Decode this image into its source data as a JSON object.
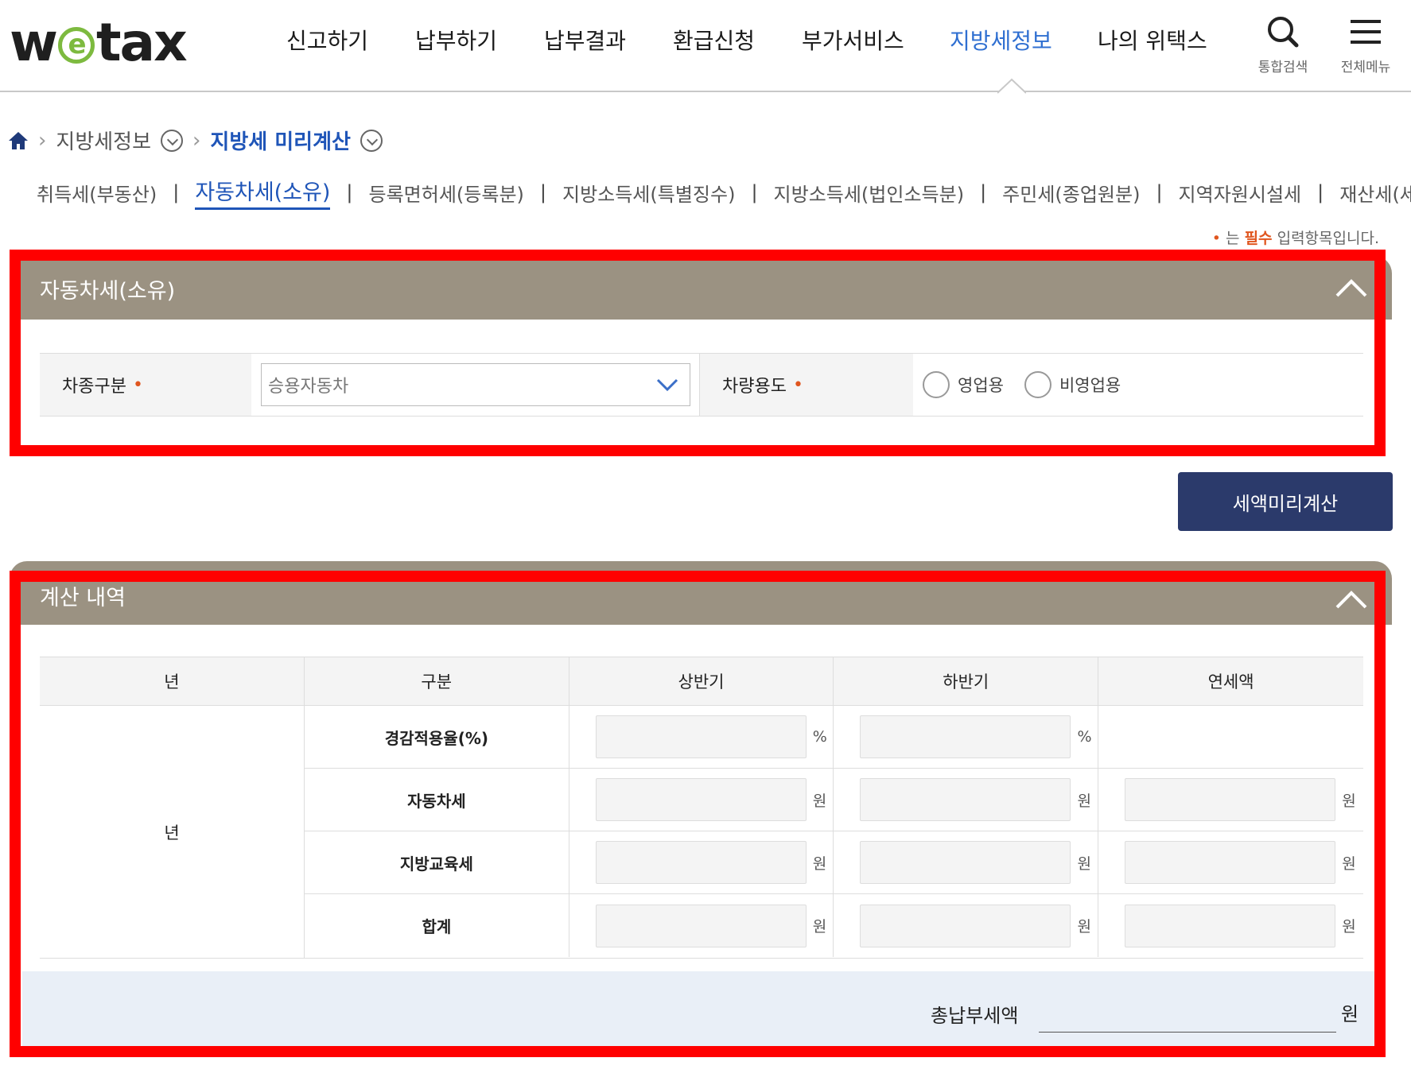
{
  "header": {
    "logo": {
      "pre": "w",
      "e": "e",
      "post": "tax"
    },
    "nav": [
      "신고하기",
      "납부하기",
      "납부결과",
      "환급신청",
      "부가서비스",
      "지방세정보",
      "나의 위택스"
    ],
    "active_nav": "지방세정보",
    "search_label": "통합검색",
    "menu_label": "전체메뉴"
  },
  "breadcrumb": {
    "level1": "지방세정보",
    "level2": "지방세 미리계산"
  },
  "subtabs": [
    "취득세(부동산)",
    "자동차세(소유)",
    "등록면허세(등록분)",
    "지방소득세(특별징수)",
    "지방소득세(법인소득분)",
    "주민세(종업원분)",
    "지역자원시설세",
    "재산세(세율특례)"
  ],
  "active_subtab": "자동차세(소유)",
  "required_note": {
    "dot": "•",
    "pre": " 는 ",
    "must": "필수",
    "post": " 입력항목입니다."
  },
  "form_panel": {
    "title": "자동차세(소유)",
    "vehicle_type_label": "차종구분",
    "vehicle_type_value": "승용자동차",
    "usage_label": "차량용도",
    "usage_options": [
      "영업용",
      "비영업용"
    ],
    "required_mark": "•"
  },
  "calc_button": "세액미리계산",
  "result_panel": {
    "title": "계산 내역",
    "columns": [
      "년",
      "구분",
      "상반기",
      "하반기",
      "연세액"
    ],
    "year_cell": "년",
    "rows": [
      {
        "label": "경감적용율(%)",
        "unit": "%",
        "annual": false
      },
      {
        "label": "자동차세",
        "unit": "원",
        "annual": true
      },
      {
        "label": "지방교육세",
        "unit": "원",
        "annual": true
      },
      {
        "label": "합계",
        "unit": "원",
        "annual": true
      }
    ],
    "total_label": "총납부세액",
    "total_unit": "원"
  },
  "colors": {
    "panel_header": "#9b9282",
    "active_blue": "#2f6fd1",
    "button_navy": "#2b3a6b",
    "highlight_red": "#ff0000",
    "required_orange": "#e0561f"
  }
}
